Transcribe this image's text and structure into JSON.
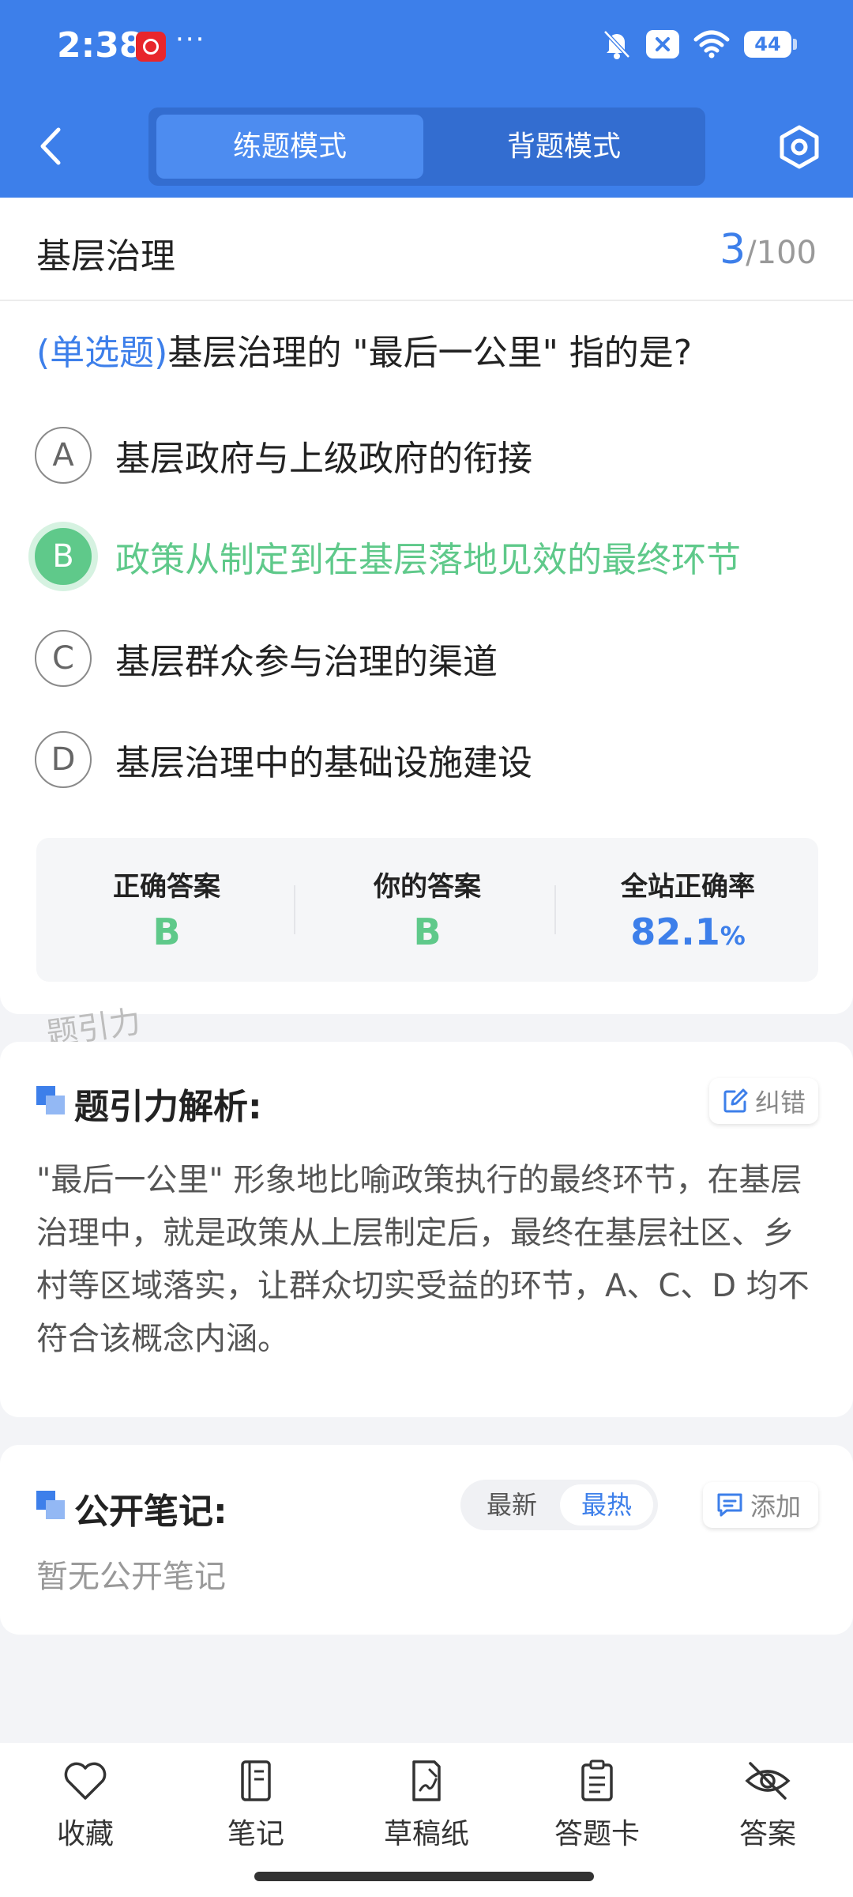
{
  "status_bar": {
    "time": "2:38",
    "more": "···",
    "battery": "44"
  },
  "header": {
    "tabs": [
      {
        "label": "练题模式"
      },
      {
        "label": "背题模式"
      }
    ]
  },
  "question": {
    "category": "基层治理",
    "current": "3",
    "total": "/100",
    "type": "(单选题)",
    "text": "基层治理的 \"最后一公里\" 指的是?",
    "options": [
      {
        "letter": "A",
        "text": "基层政府与上级政府的衔接"
      },
      {
        "letter": "B",
        "text": "政策从制定到在基层落地见效的最终环节",
        "selected": true
      },
      {
        "letter": "C",
        "text": "基层群众参与治理的渠道"
      },
      {
        "letter": "D",
        "text": "基层治理中的基础设施建设"
      }
    ]
  },
  "result": {
    "correct_label": "正确答案",
    "correct_value": "B",
    "yours_label": "你的答案",
    "yours_value": "B",
    "rate_label": "全站正确率",
    "rate_value": "82.1",
    "rate_unit": "%"
  },
  "watermark": "题引力",
  "analysis": {
    "title": "题引力解析:",
    "report_label": "纠错",
    "body": "\"最后一公里\" 形象地比喻政策执行的最终环节，在基层治理中，就是政策从上层制定后，最终在基层社区、乡村等区域落实，让群众切实受益的环节，A、C、D 均不符合该概念内涵。"
  },
  "notes": {
    "title": "公开笔记:",
    "sort_latest": "最新",
    "sort_hot": "最热",
    "add_label": "添加",
    "empty": "暂无公开笔记"
  },
  "bottom_nav": [
    {
      "label": "收藏",
      "icon": "heart-icon"
    },
    {
      "label": "笔记",
      "icon": "notebook-icon"
    },
    {
      "label": "草稿纸",
      "icon": "draft-icon"
    },
    {
      "label": "答题卡",
      "icon": "answer-card-icon"
    },
    {
      "label": "答案",
      "icon": "eye-off-icon"
    }
  ],
  "colors": {
    "primary": "#3d7fea",
    "correct": "#5fc98a"
  }
}
